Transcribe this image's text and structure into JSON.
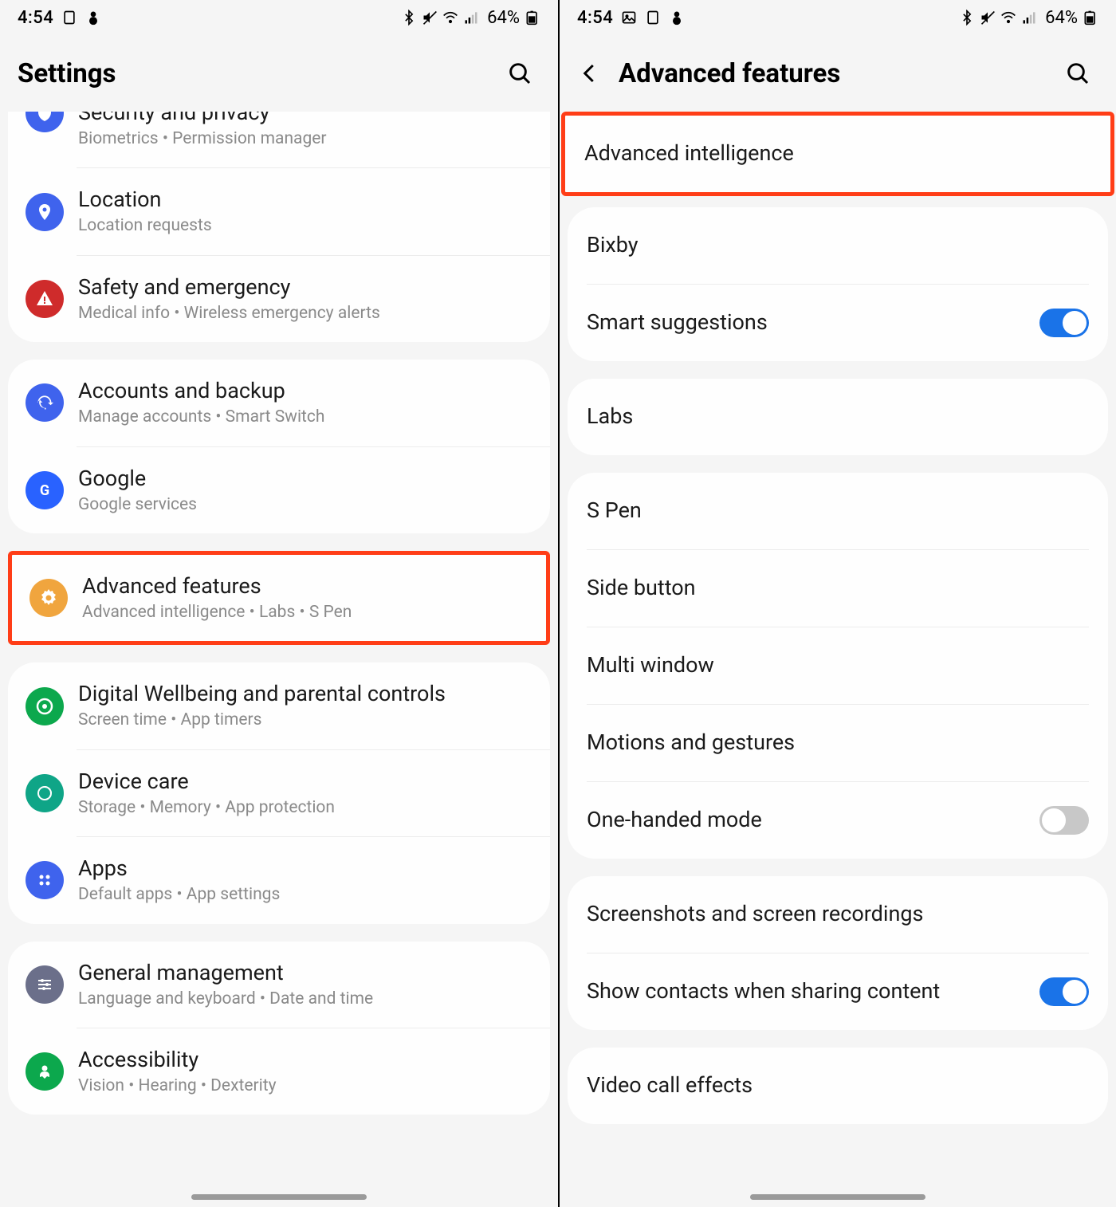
{
  "status": {
    "time": "4:54",
    "battery": "64%"
  },
  "left": {
    "title": "Settings",
    "groups": [
      {
        "first": true,
        "items": [
          {
            "icon": "shield",
            "color": "#3f63ed",
            "title": "Security and privacy",
            "sub": "Biometrics  •  Permission manager",
            "clipped": true
          },
          {
            "icon": "location",
            "color": "#3f63ed",
            "title": "Location",
            "sub": "Location requests"
          },
          {
            "icon": "alert",
            "color": "#cf2b2b",
            "title": "Safety and emergency",
            "sub": "Medical info  •  Wireless emergency alerts"
          }
        ]
      },
      {
        "items": [
          {
            "icon": "sync",
            "color": "#3f63ed",
            "title": "Accounts and backup",
            "sub": "Manage accounts  •  Smart Switch"
          },
          {
            "icon": "google",
            "color": "#2962ff",
            "title": "Google",
            "sub": "Google services"
          }
        ]
      },
      {
        "highlight": true,
        "items": [
          {
            "icon": "gear",
            "color": "#f0a53e",
            "title": "Advanced features",
            "sub": "Advanced intelligence  •  Labs  •  S Pen"
          }
        ]
      },
      {
        "items": [
          {
            "icon": "heart",
            "color": "#0ca84d",
            "title": "Digital Wellbeing and parental controls",
            "sub": "Screen time  •  App timers"
          },
          {
            "icon": "care",
            "color": "#0fa587",
            "title": "Device care",
            "sub": "Storage  •  Memory  •  App protection"
          },
          {
            "icon": "apps",
            "color": "#3f63ed",
            "title": "Apps",
            "sub": "Default apps  •  App settings"
          }
        ]
      },
      {
        "items": [
          {
            "icon": "sliders",
            "color": "#6b6f8a",
            "title": "General management",
            "sub": "Language and keyboard  •  Date and time"
          },
          {
            "icon": "person",
            "color": "#0ca84d",
            "title": "Accessibility",
            "sub": "Vision  •  Hearing  •  Dexterity"
          }
        ]
      }
    ]
  },
  "right": {
    "title": "Advanced features",
    "groups": [
      {
        "highlight": true,
        "items": [
          {
            "title": "Advanced intelligence"
          }
        ]
      },
      {
        "items": [
          {
            "title": "Bixby"
          },
          {
            "title": "Smart suggestions",
            "toggle": "on"
          }
        ]
      },
      {
        "items": [
          {
            "title": "Labs"
          }
        ]
      },
      {
        "items": [
          {
            "title": "S Pen"
          },
          {
            "title": "Side button"
          },
          {
            "title": "Multi window"
          },
          {
            "title": "Motions and gestures"
          },
          {
            "title": "One-handed mode",
            "toggle": "off"
          }
        ]
      },
      {
        "items": [
          {
            "title": "Screenshots and screen recordings"
          },
          {
            "title": "Show contacts when sharing content",
            "toggle": "on"
          }
        ]
      },
      {
        "items": [
          {
            "title": "Video call effects"
          }
        ]
      }
    ]
  }
}
